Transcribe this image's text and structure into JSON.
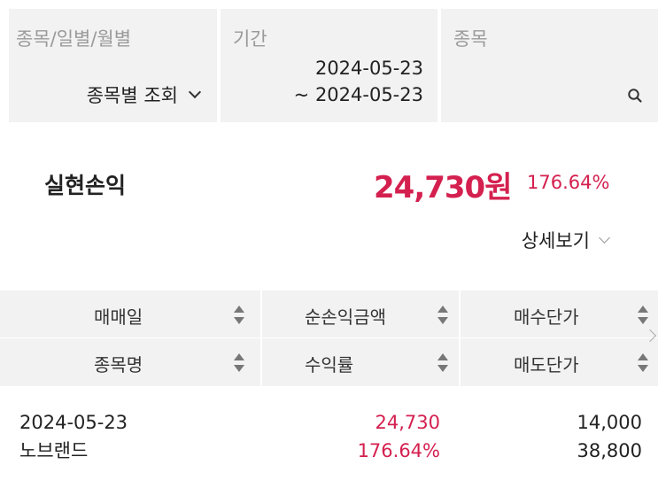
{
  "filters": {
    "type_label": "종목/일별/월별",
    "type_value": "종목별 조회",
    "period_label": "기간",
    "period_start": "2024-05-23",
    "period_end": "~ 2024-05-23",
    "stock_label": "종목",
    "stock_value": "",
    "search_icon": "search-icon"
  },
  "summary": {
    "label": "실현손익",
    "amount": "24,730원",
    "rate": "176.64%",
    "detail_label": "상세보기",
    "accent_color": "#d4204f"
  },
  "table": {
    "headers_row1": [
      "매매일",
      "순손익금액",
      "매수단가"
    ],
    "headers_row2": [
      "종목명",
      "수익률",
      "매도단가"
    ],
    "rows": [
      {
        "date": "2024-05-23",
        "name": "노브랜드",
        "profit": "24,730",
        "rate": "176.64%",
        "buy_price": "14,000",
        "sell_price": "38,800"
      }
    ]
  }
}
